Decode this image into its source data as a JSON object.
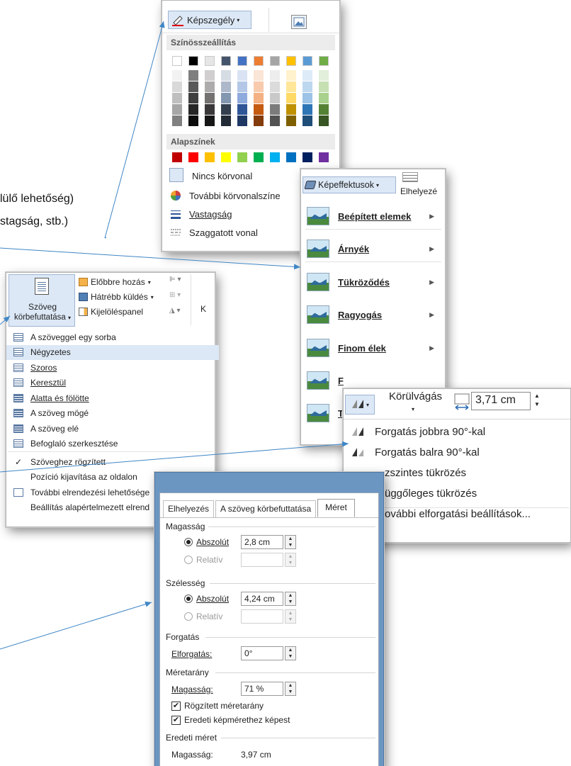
{
  "background_text": {
    "line1": "lülő lehetőség)",
    "line2": "stagság, stb.)"
  },
  "border_panel": {
    "ribbon_button": "Képszegély",
    "theme_colors_header": "Színösszeállítás",
    "standard_colors_header": "Alapszínek",
    "theme_top_row": [
      "#ffffff",
      "#000000",
      "#e7e6e6",
      "#44546a",
      "#4472c4",
      "#ed7d31",
      "#a5a5a5",
      "#ffc000",
      "#5b9bd5",
      "#70ad47"
    ],
    "theme_shades": [
      [
        "#f2f2f2",
        "#7f7f7f",
        "#d0cece",
        "#d6dce4",
        "#dae3f3",
        "#fbe5d6",
        "#ededed",
        "#fff2cc",
        "#ddebf7",
        "#e2efda"
      ],
      [
        "#d9d9d9",
        "#595959",
        "#aeabab",
        "#adb9ca",
        "#b4c7e7",
        "#f8cbad",
        "#dbdbdb",
        "#ffe699",
        "#bdd7ee",
        "#c6e0b4"
      ],
      [
        "#bfbfbf",
        "#3f3f3f",
        "#757171",
        "#8497b0",
        "#8faadc",
        "#f4b183",
        "#c9c9c9",
        "#ffd966",
        "#9dc3e6",
        "#a9d18e"
      ],
      [
        "#a6a6a6",
        "#262626",
        "#3a3838",
        "#333f4f",
        "#2f5597",
        "#c55a11",
        "#7b7b7b",
        "#bf9000",
        "#2e75b6",
        "#548235"
      ],
      [
        "#808080",
        "#0d0d0d",
        "#171616",
        "#222a35",
        "#1f3864",
        "#843c0c",
        "#525252",
        "#7f6000",
        "#1f4e79",
        "#375623"
      ]
    ],
    "standard": [
      "#c00000",
      "#ff0000",
      "#ffc000",
      "#ffff00",
      "#92d050",
      "#00b050",
      "#00b0f0",
      "#0070c0",
      "#002060",
      "#7030a0"
    ],
    "no_outline": "Nincs körvonal",
    "more_colors": "További körvonalszíne",
    "weight": "Vastagság",
    "dashes": "Szaggatott vonal"
  },
  "effects_panel": {
    "ribbon_button": "Képeffektusok",
    "position_button": "Elhelyezé",
    "items": [
      "Beépített elemek",
      "Árnyék",
      "Tükröződés",
      "Ragyogás",
      "Finom élek",
      "F",
      "T"
    ]
  },
  "wrap_panel": {
    "bring_forward": "Előbbre hozás",
    "send_backward": "Hátrébb küldés",
    "selection_pane": "Kijelöléspanel",
    "wrap_button_line1": "Szöveg",
    "wrap_button_line2": "körbefuttatása",
    "k_label": "K",
    "items": [
      "A szöveggel egy sorba",
      "Négyzetes",
      "Szoros",
      "Keresztül",
      "Alatta és fölötte",
      "A szöveg mögé",
      "A szöveg elé",
      "Befoglaló szerkesztése",
      "Szöveghez rögzített",
      "Pozíció kijavítása az oldalon",
      "További elrendezési lehetősége",
      "Beállítás alapértelmezett elrend"
    ]
  },
  "rotate_panel": {
    "crop_label": "Körülvágás",
    "width_value": "3,71 cm",
    "items": [
      "Forgatás jobbra 90°-kal",
      "Forgatás balra 90°-kal",
      "zszintes tükrözés",
      "üggőleges tükrözés",
      "ovábbi elforgatási beállítások..."
    ]
  },
  "dialog": {
    "tabs": [
      "Elhelyezés",
      "A szöveg körbefuttatása",
      "Méret"
    ],
    "height_group": "Magasság",
    "width_group": "Szélesség",
    "absolute": "Abszolút",
    "relative": "Relatív",
    "height_abs_value": "2,8 cm",
    "width_abs_value": "4,24 cm",
    "rotation_group": "Forgatás",
    "rotation_label": "Elforgatás:",
    "rotation_value": "0°",
    "scale_group": "Méretarány",
    "scale_height_label": "Magasság:",
    "scale_height_value": "71 %",
    "lock_aspect": "Rögzített méretarány",
    "relative_original": "Eredeti képmérethez képest",
    "original_group": "Eredeti méret",
    "original_height_label": "Magasság:",
    "original_height_value": "3,97 cm"
  }
}
